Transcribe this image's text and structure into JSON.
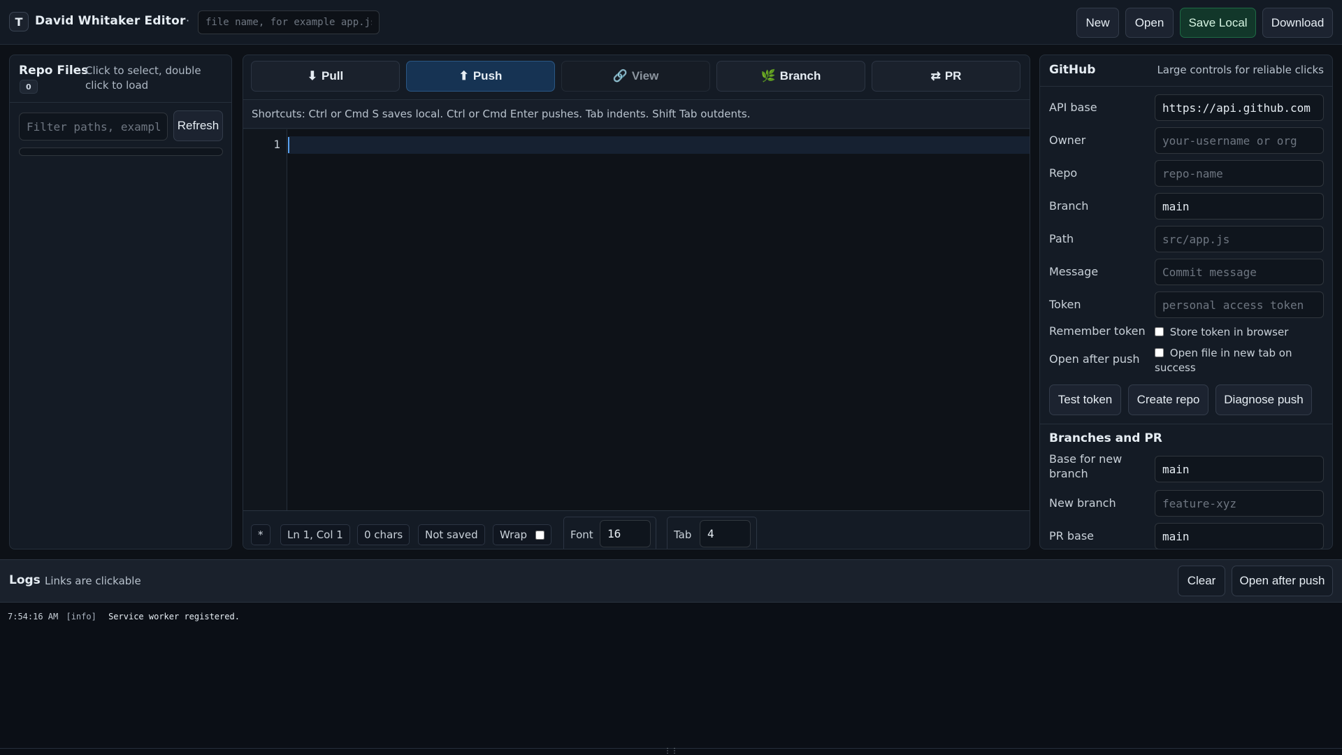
{
  "app": {
    "logo_letter": "T",
    "title": "David Whitaker Editor",
    "separator": "·",
    "filename_placeholder": "file name, for example app.js"
  },
  "toolbar": {
    "new_label": "New",
    "open_label": "Open",
    "save_local_label": "Save Local",
    "download_label": "Download"
  },
  "repo_files": {
    "title": "Repo Files",
    "count": "0",
    "hint": "Click to select, double click to load",
    "filter_placeholder": "Filter paths, example src/",
    "refresh_label": "Refresh"
  },
  "editor": {
    "actions": {
      "pull": {
        "icon": "download-arrow-icon",
        "glyph": "⬇",
        "label": "Pull"
      },
      "push": {
        "icon": "upload-arrow-icon",
        "glyph": "⬆",
        "label": "Push"
      },
      "view": {
        "icon": "link-icon",
        "glyph": "🔗",
        "label": "View"
      },
      "branch": {
        "icon": "leaf-icon",
        "glyph": "🌿",
        "label": "Branch"
      },
      "pr": {
        "icon": "swap-arrows-icon",
        "glyph": "⇄",
        "label": "PR"
      }
    },
    "shortcuts": "Shortcuts: Ctrl or Cmd S saves local. Ctrl or Cmd Enter pushes. Tab indents. Shift Tab outdents.",
    "line_numbers": [
      "1"
    ],
    "content": ""
  },
  "status": {
    "modified_marker": "*",
    "cursor": "Ln 1, Col 1",
    "chars": "0 chars",
    "save_state": "Not saved",
    "wrap_label": "Wrap",
    "wrap_checked": false,
    "font_label": "Font",
    "font_value": "16",
    "tab_label": "Tab",
    "tab_value": "4"
  },
  "github": {
    "title": "GitHub",
    "hint": "Large controls for reliable clicks",
    "fields": {
      "api_base": {
        "label": "API base",
        "value": "https://api.github.com",
        "placeholder": ""
      },
      "owner": {
        "label": "Owner",
        "value": "",
        "placeholder": "your-username or org"
      },
      "repo": {
        "label": "Repo",
        "value": "",
        "placeholder": "repo-name"
      },
      "branch": {
        "label": "Branch",
        "value": "main",
        "placeholder": ""
      },
      "path": {
        "label": "Path",
        "value": "",
        "placeholder": "src/app.js"
      },
      "message": {
        "label": "Message",
        "value": "",
        "placeholder": "Commit message"
      },
      "token": {
        "label": "Token",
        "value": "",
        "placeholder": "personal access token"
      }
    },
    "remember_token": {
      "label": "Remember token",
      "option": "Store token in browser",
      "checked": false
    },
    "open_after_push": {
      "label": "Open after push",
      "option": "Open file in new tab on success",
      "checked": false
    },
    "buttons": {
      "test_token": "Test token",
      "create_repo": "Create repo",
      "diagnose_push": "Diagnose push"
    },
    "branches_pr": {
      "title": "Branches and PR",
      "base_label": "Base for new branch",
      "base_value": "main",
      "new_branch_label": "New branch",
      "new_branch_placeholder": "feature-xyz",
      "pr_base_label": "PR base",
      "pr_base_value": "main"
    }
  },
  "logs": {
    "title": "Logs",
    "hint": "Links are clickable",
    "clear_label": "Clear",
    "open_after_push_label": "Open after push",
    "entries": [
      {
        "time": "7:54:16 AM",
        "level": "[info]",
        "message": "Service worker registered."
      }
    ],
    "resize_handle": "⋮⋮"
  }
}
